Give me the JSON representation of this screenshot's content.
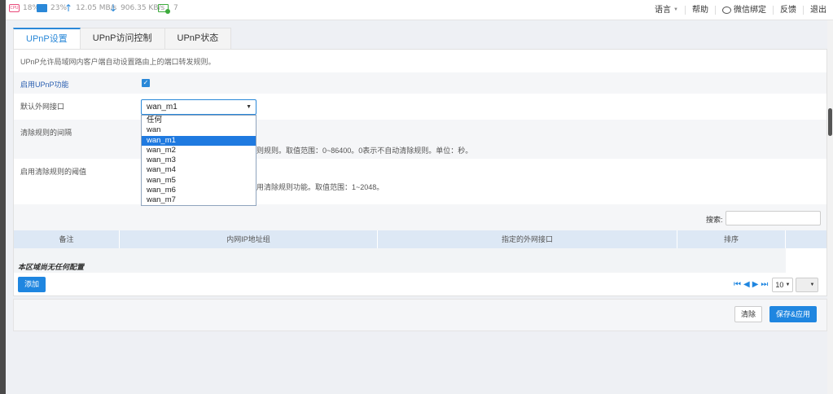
{
  "status": {
    "cpu": "18%",
    "ram": "23%",
    "upload": "12.05 MB/s",
    "download": "906.35 KB/s",
    "devices": "7"
  },
  "top_menu": {
    "language": "语言",
    "help": "帮助",
    "wechat": "微信绑定",
    "feedback": "反馈",
    "logout": "退出"
  },
  "tabs": [
    "UPnP设置",
    "UPnP访问控制",
    "UPnP状态"
  ],
  "description": "UPnP允许局域网内客户端自动设置路由上的端口转发规则。",
  "form": {
    "enable_label": "启用UPnP功能",
    "enable_checked": true,
    "wan_label": "默认外网接口",
    "wan_value": "wan_m1",
    "wan_options": [
      "任何",
      "wan",
      "wan_m1",
      "wan_m2",
      "wan_m3",
      "wan_m4",
      "wan_m5",
      "wan_m6",
      "wan_m7"
    ],
    "clear_interval_label": "清除规则的间隔",
    "clear_interval_hint": "则规则。取值范围：0~86400。0表示不自动清除规则。单位：秒。",
    "clear_threshold_label": "启用清除规则的阈值",
    "clear_threshold_hint": "用清除规则功能。取值范围：1~2048。"
  },
  "search": {
    "label": "搜索:",
    "value": ""
  },
  "table": {
    "columns": [
      "备注",
      "内网IP地址组",
      "指定的外网接口",
      "排序"
    ],
    "empty_text": "本区域尚无任何配置"
  },
  "buttons": {
    "add": "添加",
    "clear": "清除",
    "save": "保存&应用"
  },
  "pager": {
    "page_size": "10"
  },
  "colors": {
    "accent": "#1f86e0",
    "header_bg": "#dde8f5"
  }
}
